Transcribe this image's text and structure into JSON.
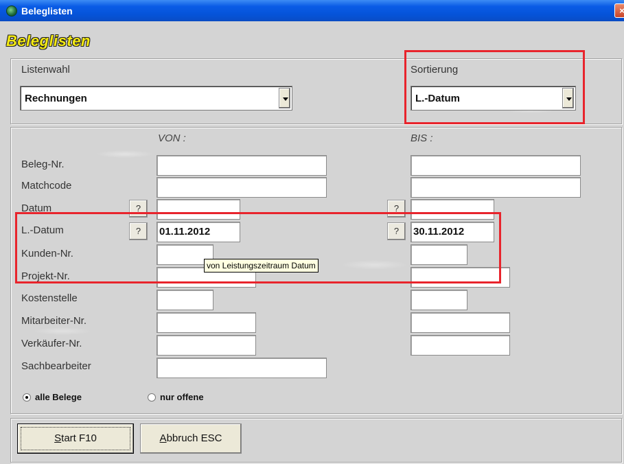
{
  "window": {
    "title": "Beleglisten",
    "close_glyph": "×"
  },
  "header": {
    "title": "Beleglisten"
  },
  "listenwahl": {
    "label": "Listenwahl",
    "value": "Rechnungen"
  },
  "sortierung": {
    "label": "Sortierung",
    "value": "L.-Datum"
  },
  "columns": {
    "von": "VON :",
    "bis": "BIS :"
  },
  "rows": [
    {
      "label": "Beleg-Nr.",
      "von": "",
      "bis": ""
    },
    {
      "label": "Matchcode",
      "von": "",
      "bis": ""
    },
    {
      "label": "Datum",
      "von": "",
      "bis": ""
    },
    {
      "label": "L.-Datum",
      "von": "01.11.2012",
      "bis": "30.11.2012"
    },
    {
      "label": "Kunden-Nr.",
      "von": "",
      "bis": ""
    },
    {
      "label": "Projekt-Nr.",
      "von": "",
      "bis": ""
    },
    {
      "label": "Kostenstelle",
      "von": "",
      "bis": ""
    },
    {
      "label": "Mitarbeiter-Nr.",
      "von": "",
      "bis": ""
    },
    {
      "label": "Verkäufer-Nr.",
      "von": "",
      "bis": ""
    },
    {
      "label": "Sachbearbeiter",
      "von": ""
    }
  ],
  "lookup_glyph": "?",
  "tooltip": "von Leistungszeitraum Datum",
  "filter": {
    "all": "alle Belege",
    "open": "nur offene",
    "selected": "all"
  },
  "buttons": {
    "start": "Start F10",
    "start_key": "S",
    "start_rest": "tart F10",
    "cancel": "Abbruch ESC",
    "cancel_key": "A",
    "cancel_rest": "bbruch ESC"
  },
  "colors": {
    "highlight": "#e8242c",
    "title_yellow": "#f4ea12",
    "titlebar_blue": "#0553d8"
  }
}
